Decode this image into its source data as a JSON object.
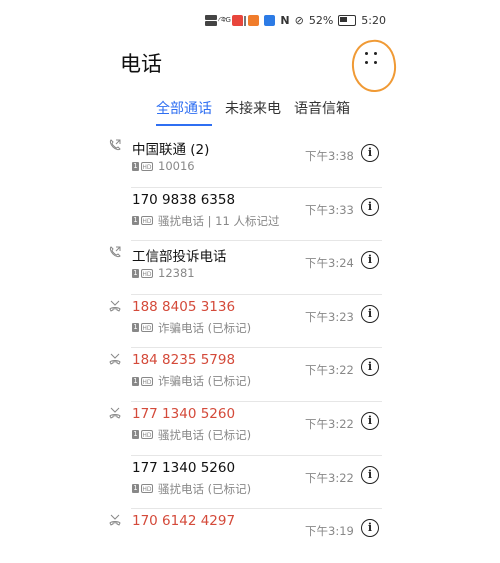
{
  "status_bar": {
    "signal_label": "4G",
    "battery_percent": "52%",
    "time": "5:20",
    "app_icon_colors": [
      "#e8453c",
      "#f07c2b",
      "#2c7be5"
    ]
  },
  "header": {
    "title": "电话"
  },
  "tabs": [
    {
      "label": "全部通话",
      "active": true
    },
    {
      "label": "未接来电",
      "active": false
    },
    {
      "label": "语音信箱",
      "active": false
    }
  ],
  "calls": [
    {
      "name": "中国联通 (2)",
      "detail": "10016",
      "time": "下午3:38",
      "type": "outgoing",
      "missed": false
    },
    {
      "name": "170 9838 6358",
      "detail": "骚扰电话 | 11 人标记过",
      "time": "下午3:33",
      "type": "none",
      "missed": false
    },
    {
      "name": "工信部投诉电话",
      "detail": "12381",
      "time": "下午3:24",
      "type": "outgoing",
      "missed": false
    },
    {
      "name": "188 8405 3136",
      "detail": "诈骗电话 (已标记)",
      "time": "下午3:23",
      "type": "missed",
      "missed": true
    },
    {
      "name": "184 8235 5798",
      "detail": "诈骗电话 (已标记)",
      "time": "下午3:22",
      "type": "missed",
      "missed": true
    },
    {
      "name": "177 1340 5260",
      "detail": "骚扰电话 (已标记)",
      "time": "下午3:22",
      "type": "missed",
      "missed": true
    },
    {
      "name": "177 1340 5260",
      "detail": "骚扰电话 (已标记)",
      "time": "下午3:22",
      "type": "none",
      "missed": false
    },
    {
      "name": "170 6142 4297",
      "detail": "",
      "time": "下午3:19",
      "type": "missed",
      "missed": true
    }
  ],
  "icons": {
    "more": "more-dots-icon",
    "info": "info-icon",
    "outgoing": "outgoing-call-icon",
    "missed": "missed-call-icon"
  },
  "colors": {
    "accent": "#2f6ff2",
    "missed": "#d44a3a",
    "annotation": "#f09a35"
  }
}
